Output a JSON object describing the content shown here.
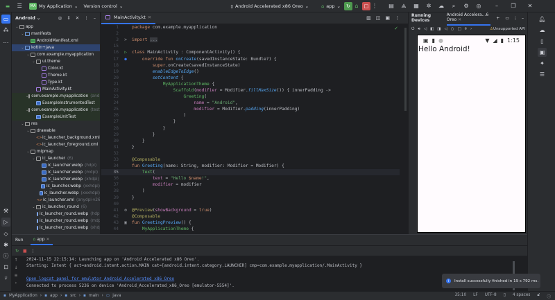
{
  "titlebar": {
    "project": "My Application",
    "project_badge": "MA",
    "vcs": "Version control",
    "device": "Android Accelerated x86 Oreo",
    "run_config": "app"
  },
  "project_panel": {
    "title": "Android",
    "items": [
      {
        "d": 0,
        "c": "v",
        "i": "folder",
        "label": "app",
        "hint": ""
      },
      {
        "d": 1,
        "c": "v",
        "i": "dir",
        "label": "manifests",
        "hint": ""
      },
      {
        "d": 2,
        "c": "",
        "i": "mani",
        "label": "AndroidManifest.xml",
        "hint": ""
      },
      {
        "d": 1,
        "c": "v",
        "i": "dir",
        "label": "kotlin+java",
        "hint": "",
        "sel": true
      },
      {
        "d": 2,
        "c": "v",
        "i": "folder",
        "label": "com.example.myapplication",
        "hint": ""
      },
      {
        "d": 3,
        "c": "v",
        "i": "folder",
        "label": "ui.theme",
        "hint": ""
      },
      {
        "d": 4,
        "c": "",
        "i": "kt",
        "label": "Color.kt",
        "hint": ""
      },
      {
        "d": 4,
        "c": "",
        "i": "kt",
        "label": "Theme.kt",
        "hint": ""
      },
      {
        "d": 4,
        "c": "",
        "i": "kt",
        "label": "Type.kt",
        "hint": ""
      },
      {
        "d": 3,
        "c": "",
        "i": "kt",
        "label": "MainActivity.kt",
        "hint": ""
      },
      {
        "d": 2,
        "c": "v",
        "i": "folder",
        "label": "com.example.myapplication",
        "hint": "(androidTest)",
        "green": true
      },
      {
        "d": 3,
        "c": "",
        "i": "img",
        "label": "ExampleInstrumentedTest",
        "hint": "",
        "green": true
      },
      {
        "d": 2,
        "c": "v",
        "i": "folder",
        "label": "com.example.myapplication",
        "hint": "(test)",
        "green": true
      },
      {
        "d": 3,
        "c": "",
        "i": "img",
        "label": "ExampleUnitTest",
        "hint": "",
        "green": true
      },
      {
        "d": 1,
        "c": "v",
        "i": "folder",
        "label": "res",
        "hint": ""
      },
      {
        "d": 2,
        "c": "v",
        "i": "folder",
        "label": "drawable",
        "hint": ""
      },
      {
        "d": 3,
        "c": "",
        "i": "xml",
        "label": "ic_launcher_background.xml",
        "hint": ""
      },
      {
        "d": 3,
        "c": "",
        "i": "xml",
        "label": "ic_launcher_foreground.xml",
        "hint": ""
      },
      {
        "d": 2,
        "c": "v",
        "i": "folder",
        "label": "mipmap",
        "hint": ""
      },
      {
        "d": 3,
        "c": "v",
        "i": "folder",
        "label": "ic_launcher",
        "hint": "(6)"
      },
      {
        "d": 4,
        "c": "",
        "i": "img",
        "label": "ic_launcher.webp",
        "hint": "(hdpi)"
      },
      {
        "d": 4,
        "c": "",
        "i": "img",
        "label": "ic_launcher.webp",
        "hint": "(mdpi)"
      },
      {
        "d": 4,
        "c": "",
        "i": "img",
        "label": "ic_launcher.webp",
        "hint": "(xhdpi)"
      },
      {
        "d": 4,
        "c": "",
        "i": "img",
        "label": "ic_launcher.webp",
        "hint": "(xxhdpi)"
      },
      {
        "d": 4,
        "c": "",
        "i": "img",
        "label": "ic_launcher.webp",
        "hint": "(xxxhdpi)"
      },
      {
        "d": 4,
        "c": "",
        "i": "xml",
        "label": "ic_launcher.xml",
        "hint": "(anydpi-v26)"
      },
      {
        "d": 3,
        "c": "v",
        "i": "folder",
        "label": "ic_launcher_round",
        "hint": "(6)"
      },
      {
        "d": 4,
        "c": "",
        "i": "img",
        "label": "ic_launcher_round.webp",
        "hint": "(hdpi)"
      },
      {
        "d": 4,
        "c": "",
        "i": "img",
        "label": "ic_launcher_round.webp",
        "hint": "(mdpi)"
      },
      {
        "d": 4,
        "c": "",
        "i": "img",
        "label": "ic_launcher_round.webp",
        "hint": "(xhdpi)"
      }
    ]
  },
  "editor": {
    "tab": "MainActivity.kt",
    "lines": [
      {
        "n": "1",
        "t": [
          [
            "package",
            "k"
          ],
          [
            " com.example.myapplication",
            "n"
          ]
        ]
      },
      {
        "n": "2",
        "t": []
      },
      {
        "n": "3",
        "g": ">",
        "t": [
          [
            "import",
            "k"
          ],
          [
            " ",
            "n"
          ],
          [
            "...",
            "fold"
          ]
        ]
      },
      {
        "n": "15",
        "t": []
      },
      {
        "n": "16",
        "g": "▷",
        "t": [
          [
            "class",
            "k"
          ],
          [
            " MainActivity : ComponentActivity() {",
            "n"
          ]
        ]
      },
      {
        "n": "17",
        "g": "●",
        "t": [
          [
            "    override fun ",
            "k"
          ],
          [
            "onCreate",
            "f"
          ],
          [
            "(savedInstanceState: Bundle?) {",
            "n"
          ]
        ]
      },
      {
        "n": "18",
        "t": [
          [
            "        super",
            "k"
          ],
          [
            ".onCreate(savedInstanceState)",
            "n"
          ]
        ]
      },
      {
        "n": "19",
        "t": [
          [
            "        ",
            "n"
          ],
          [
            "enableEdgeToEdge",
            "fi"
          ],
          [
            "()",
            "n"
          ]
        ]
      },
      {
        "n": "20",
        "t": [
          [
            "        ",
            "n"
          ],
          [
            "setContent",
            "fi"
          ],
          [
            " {",
            "n"
          ]
        ]
      },
      {
        "n": "21",
        "t": [
          [
            "            ",
            "n"
          ],
          [
            "MyApplicationTheme",
            "g"
          ],
          [
            " {",
            "n"
          ]
        ]
      },
      {
        "n": "22",
        "t": [
          [
            "                ",
            "n"
          ],
          [
            "Scaffold",
            "g"
          ],
          [
            "(",
            "n"
          ],
          [
            "modifier",
            "p"
          ],
          [
            " = Modifier.",
            "n"
          ],
          [
            "fillMaxSize",
            "fi"
          ],
          [
            "()) { innerPadding ->",
            "n"
          ]
        ]
      },
      {
        "n": "23",
        "t": [
          [
            "                    ",
            "n"
          ],
          [
            "Greeting",
            "g"
          ],
          [
            "(",
            "n"
          ]
        ]
      },
      {
        "n": "24",
        "t": [
          [
            "                        ",
            "n"
          ],
          [
            "name",
            "p"
          ],
          [
            " = ",
            "n"
          ],
          [
            "\"Android\"",
            "s"
          ],
          [
            ",",
            "n"
          ]
        ]
      },
      {
        "n": "25",
        "t": [
          [
            "                        ",
            "n"
          ],
          [
            "modifier",
            "p"
          ],
          [
            " = Modifier.",
            "n"
          ],
          [
            "padding",
            "fi"
          ],
          [
            "(innerPadding)",
            "n"
          ]
        ]
      },
      {
        "n": "26",
        "t": [
          [
            "                    )",
            "n"
          ]
        ]
      },
      {
        "n": "27",
        "t": [
          [
            "                }",
            "n"
          ]
        ]
      },
      {
        "n": "28",
        "t": [
          [
            "            }",
            "n"
          ]
        ]
      },
      {
        "n": "29",
        "t": [
          [
            "        }",
            "n"
          ]
        ]
      },
      {
        "n": "30",
        "t": [
          [
            "    }",
            "n"
          ]
        ]
      },
      {
        "n": "31",
        "t": [
          [
            "}",
            "n"
          ]
        ]
      },
      {
        "n": "32",
        "t": []
      },
      {
        "n": "33",
        "t": [
          [
            "@Composable",
            "a"
          ]
        ]
      },
      {
        "n": "34",
        "t": [
          [
            "fun ",
            "k"
          ],
          [
            "Greeting",
            "f"
          ],
          [
            "(name: String, modifier: Modifier = Modifier) {",
            "n"
          ]
        ]
      },
      {
        "n": "35",
        "cur": true,
        "t": [
          [
            "    ",
            "n"
          ],
          [
            "Text",
            "g"
          ],
          [
            "(",
            "n"
          ]
        ]
      },
      {
        "n": "36",
        "t": [
          [
            "        ",
            "n"
          ],
          [
            "text",
            "p"
          ],
          [
            " = ",
            "n"
          ],
          [
            "\"Hello ",
            "s"
          ],
          [
            "$name",
            "k"
          ],
          [
            "!\"",
            "s"
          ],
          [
            ",",
            "n"
          ]
        ]
      },
      {
        "n": "37",
        "t": [
          [
            "        ",
            "n"
          ],
          [
            "modifier",
            "p"
          ],
          [
            " = modifier",
            "n"
          ]
        ]
      },
      {
        "n": "38",
        "t": [
          [
            "    )",
            "n"
          ]
        ]
      },
      {
        "n": "39",
        "t": [
          [
            "}",
            "n"
          ]
        ]
      },
      {
        "n": "40",
        "t": []
      },
      {
        "n": "41",
        "g": "⚙",
        "t": [
          [
            "@Preview",
            "a"
          ],
          [
            "(",
            "n"
          ],
          [
            "showBackground",
            "p"
          ],
          [
            " = ",
            "n"
          ],
          [
            "true",
            "k"
          ],
          [
            ")",
            "n"
          ]
        ]
      },
      {
        "n": "42",
        "t": [
          [
            "@Composable",
            "a"
          ]
        ]
      },
      {
        "n": "43",
        "g": "▣",
        "t": [
          [
            "fun ",
            "k"
          ],
          [
            "GreetingPreview",
            "f"
          ],
          [
            "() {",
            "n"
          ]
        ]
      },
      {
        "n": "44",
        "t": [
          [
            "    ",
            "n"
          ],
          [
            "MyApplicationTheme",
            "g"
          ],
          [
            " {",
            "n"
          ]
        ]
      }
    ]
  },
  "devices": {
    "title": "Running Devices",
    "tab": "Android Accelera...6 Oreo",
    "warning": "Unsupported API",
    "clock": "1:15",
    "screen_text": "Hello Android!",
    "zoom_reset": "1:1"
  },
  "run": {
    "label": "Run",
    "tab": "app",
    "log": [
      "2024-11-15 22:15:14: Launching app on 'Android Accelerated x86 Oreo'.",
      "Starting: Intent { act=android.intent.action.MAIN cat=[android.intent.category.LAUNCHER] cmp=com.example.myapplication/.MainActivity }",
      "",
      "Open logcat panel for emulator Android Accelerated x86 Oreo",
      "Connected to process 5236 on device 'Android_Accelerated_x86_Oreo [emulator-5554]'."
    ]
  },
  "toast": "Install successfully finished in 19 s 792 ms.",
  "status": {
    "breadcrumbs": [
      "MyApplication",
      "app",
      "src",
      "main",
      "java"
    ],
    "position": "35:10",
    "line_sep": "LF",
    "encoding": "UTF-8",
    "indent": "4 spaces"
  }
}
